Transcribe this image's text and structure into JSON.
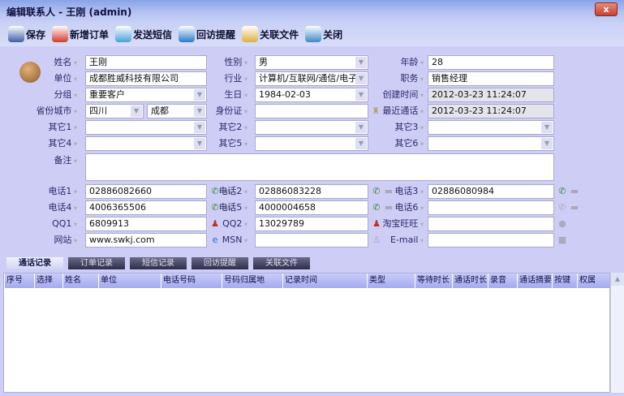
{
  "window": {
    "title": "编辑联系人 - 王刚  (admin)",
    "close": "x"
  },
  "toolbar": [
    {
      "label": "保存",
      "icon": "save-icon",
      "color": "#3a5fa8"
    },
    {
      "label": "新增订单",
      "icon": "new-order-icon",
      "color": "#d43a2a"
    },
    {
      "label": "发送短信",
      "icon": "send-sms-icon",
      "color": "#4aa0d8"
    },
    {
      "label": "回访提醒",
      "icon": "reminder-icon",
      "color": "#2a7ac8"
    },
    {
      "label": "关联文件",
      "icon": "folder-icon",
      "color": "#e0b040"
    },
    {
      "label": "关闭",
      "icon": "close-door-icon",
      "color": "#3a8ac8"
    }
  ],
  "fields": {
    "name": {
      "label": "姓名",
      "value": "王刚"
    },
    "gender": {
      "label": "性别",
      "value": "男"
    },
    "age": {
      "label": "年龄",
      "value": "28"
    },
    "company": {
      "label": "单位",
      "value": "成都胜威科技有限公司"
    },
    "industry": {
      "label": "行业",
      "value": "计算机/互联网/通信/电子"
    },
    "position": {
      "label": "职务",
      "value": "销售经理"
    },
    "group": {
      "label": "分组",
      "value": "重要客户"
    },
    "birthday": {
      "label": "生日",
      "value": "1984-02-03"
    },
    "created": {
      "label": "创建时间",
      "value": "2012-03-23 11:24:07"
    },
    "province_city": {
      "label": "省份城市",
      "province": "四川",
      "city": "成都"
    },
    "id_card": {
      "label": "身份证",
      "value": ""
    },
    "last_call": {
      "label": "最近通话",
      "value": "2012-03-23 11:24:07"
    },
    "other1": {
      "label": "其它1",
      "value": ""
    },
    "other2": {
      "label": "其它2",
      "value": ""
    },
    "other3": {
      "label": "其它3",
      "value": ""
    },
    "other4": {
      "label": "其它4",
      "value": ""
    },
    "other5": {
      "label": "其它5",
      "value": ""
    },
    "other6": {
      "label": "其它6",
      "value": ""
    },
    "remark": {
      "label": "备注",
      "value": ""
    },
    "phone1": {
      "label": "电话1",
      "value": "02886082660"
    },
    "phone2": {
      "label": "电话2",
      "value": "02886083228"
    },
    "phone3": {
      "label": "电话3",
      "value": "02886080984"
    },
    "phone4": {
      "label": "电话4",
      "value": "4006365506"
    },
    "phone5": {
      "label": "电话5",
      "value": "4000004658"
    },
    "phone6": {
      "label": "电话6",
      "value": ""
    },
    "qq1": {
      "label": "QQ1",
      "value": "6809913"
    },
    "qq2": {
      "label": "QQ2",
      "value": "13029789"
    },
    "wangwang": {
      "label": "淘宝旺旺",
      "value": ""
    },
    "website": {
      "label": "网站",
      "value": "www.swkj.com"
    },
    "msn": {
      "label": "MSN",
      "value": ""
    },
    "email": {
      "label": "E-mail",
      "value": ""
    }
  },
  "tabs": [
    "通话记录",
    "订单记录",
    "短信记录",
    "回访提醒",
    "关联文件"
  ],
  "grid_columns": [
    "序号",
    "选择",
    "姓名",
    "单位",
    "电话号码",
    "号码归属地",
    "记录时间",
    "类型",
    "等待时长",
    "通话时长",
    "录音",
    "通话摘要",
    "按键",
    "权属"
  ]
}
